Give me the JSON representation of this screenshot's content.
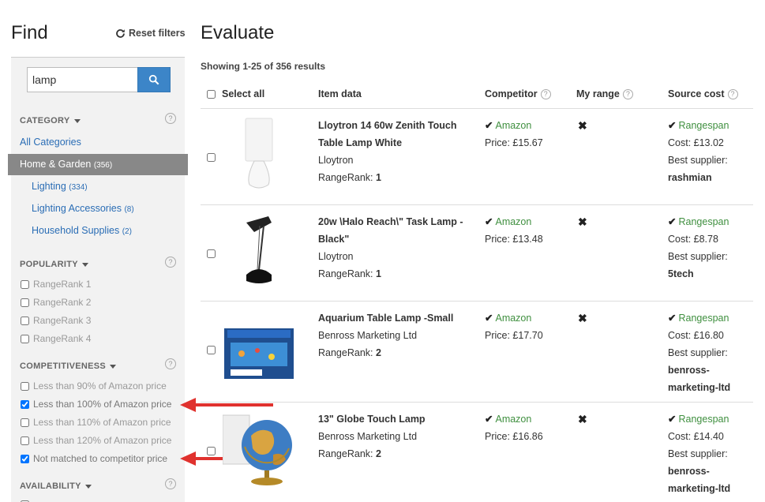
{
  "find": {
    "title": "Find",
    "reset_label": "Reset filters",
    "search": {
      "value": "lamp",
      "placeholder": ""
    }
  },
  "category": {
    "heading": "CATEGORY",
    "help": "?",
    "all_label": "All Categories",
    "selected": {
      "label": "Home & Garden",
      "count": "(356)"
    },
    "children": [
      {
        "label": "Lighting",
        "count": "(334)"
      },
      {
        "label": "Lighting Accessories",
        "count": "(8)"
      },
      {
        "label": "Household Supplies",
        "count": "(2)"
      }
    ]
  },
  "popularity": {
    "heading": "POPULARITY",
    "help": "?",
    "options": [
      {
        "label": "RangeRank 1",
        "checked": false
      },
      {
        "label": "RangeRank 2",
        "checked": false
      },
      {
        "label": "RangeRank 3",
        "checked": false
      },
      {
        "label": "RangeRank 4",
        "checked": false
      }
    ]
  },
  "competitiveness": {
    "heading": "COMPETITIVENESS",
    "help": "?",
    "options": [
      {
        "label": "Less than 90% of Amazon price",
        "checked": false
      },
      {
        "label": "Less than 100% of Amazon price",
        "checked": true
      },
      {
        "label": "Less than 110% of Amazon price",
        "checked": false
      },
      {
        "label": "Less than 120% of Amazon price",
        "checked": false
      },
      {
        "label": "Not matched to competitor price",
        "checked": true
      }
    ]
  },
  "availability": {
    "heading": "AVAILABILITY",
    "help": "?"
  },
  "evaluate": {
    "title": "Evaluate",
    "showing": "Showing 1-25 of 356 results",
    "columns": {
      "select_all": "Select all",
      "item_data": "Item data",
      "competitor": "Competitor",
      "my_range": "My range",
      "source_cost": "Source cost",
      "help": "?"
    },
    "rows": [
      {
        "title": "Lloytron 14 60w Zenith Touch Table Lamp White",
        "brand": "Lloytron",
        "rank_label": "RangeRank:",
        "rank": "1",
        "competitor": "Amazon",
        "price": "Price: £15.67",
        "my_range": "✖",
        "source": "Rangespan",
        "cost": "Cost: £13.02",
        "best_label": "Best supplier:",
        "supplier": "rashmian"
      },
      {
        "title": "20w \\Halo Reach\\\" Task Lamp - Black\"",
        "brand": "Lloytron",
        "rank_label": "RangeRank:",
        "rank": "1",
        "competitor": "Amazon",
        "price": "Price: £13.48",
        "my_range": "✖",
        "source": "Rangespan",
        "cost": "Cost: £8.78",
        "best_label": "Best supplier:",
        "supplier": "5tech"
      },
      {
        "title": "Aquarium Table Lamp -Small",
        "brand": "Benross Marketing Ltd",
        "rank_label": "RangeRank:",
        "rank": "2",
        "competitor": "Amazon",
        "price": "Price: £17.70",
        "my_range": "✖",
        "source": "Rangespan",
        "cost": "Cost: £16.80",
        "best_label": "Best supplier:",
        "supplier": "benross-marketing-ltd"
      },
      {
        "title": "13\" Globe Touch Lamp",
        "brand": "Benross Marketing Ltd",
        "rank_label": "RangeRank:",
        "rank": "2",
        "competitor": "Amazon",
        "price": "Price: £16.86",
        "my_range": "✖",
        "source": "Rangespan",
        "cost": "Cost: £14.40",
        "best_label": "Best supplier:",
        "supplier": "benross-marketing-ltd"
      }
    ]
  },
  "colors": {
    "accent_blue": "#3c85c8",
    "link_blue": "#2a6db5",
    "green": "#3f8f3f",
    "annotation_red": "#e0322e",
    "sidebar_bg": "#f2f2f2",
    "selected_bg": "#888888"
  }
}
